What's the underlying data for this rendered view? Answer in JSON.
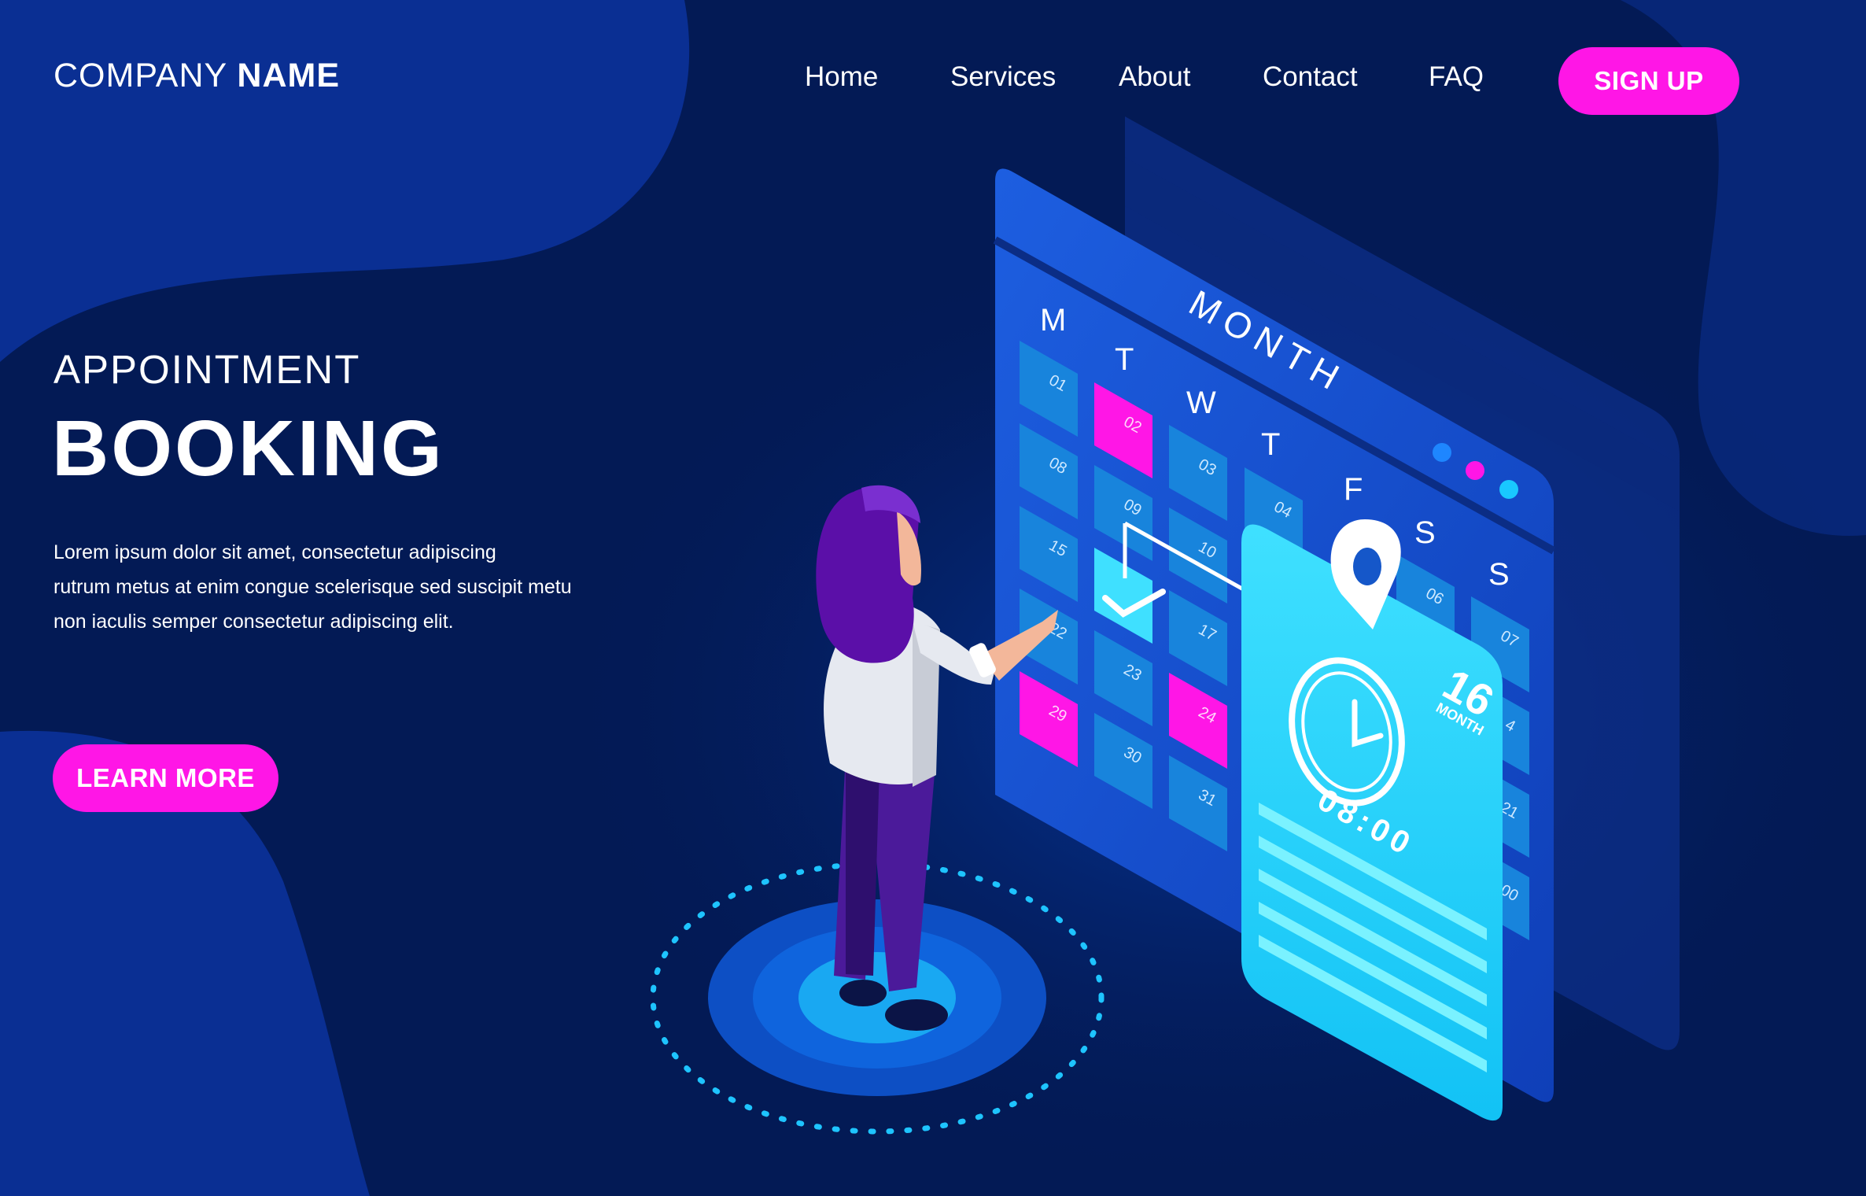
{
  "brand": {
    "name_regular": "COMPANY",
    "name_bold": "NAME"
  },
  "nav": {
    "items": [
      {
        "label": "Home"
      },
      {
        "label": "Services"
      },
      {
        "label": "About"
      },
      {
        "label": "Contact"
      },
      {
        "label": "FAQ"
      }
    ],
    "signup_label": "SIGN UP"
  },
  "hero": {
    "subtitle": "APPOINTMENT",
    "title": "BOOKING",
    "body_lines": [
      "Lorem ipsum dolor sit amet, consectetur adipiscing",
      "rutrum metus at enim congue scelerisque sed suscipit metu",
      "non iaculis semper consectetur adipiscing elit."
    ],
    "cta_label": "LEARN MORE"
  },
  "calendar": {
    "title": "MONTH",
    "weekdays": [
      "M",
      "T",
      "W",
      "T",
      "F",
      "S",
      "S"
    ],
    "dates": [
      "01",
      "02",
      "03",
      "04",
      "06",
      "07",
      "08",
      "09",
      "10",
      "15",
      "17",
      "22",
      "23",
      "24",
      "29",
      "30",
      "31",
      "4",
      "21",
      "00"
    ],
    "highlighted_dates": [
      "02",
      "24",
      "29"
    ],
    "dots": [
      "#1e86ff",
      "#ff16e6",
      "#19c8ff"
    ]
  },
  "appointment_card": {
    "day": "16",
    "day_label": "MONTH",
    "time": "08:00"
  },
  "colors": {
    "background": "#031a55",
    "accent": "#ff16e6",
    "cyan": "#19d4ff"
  }
}
